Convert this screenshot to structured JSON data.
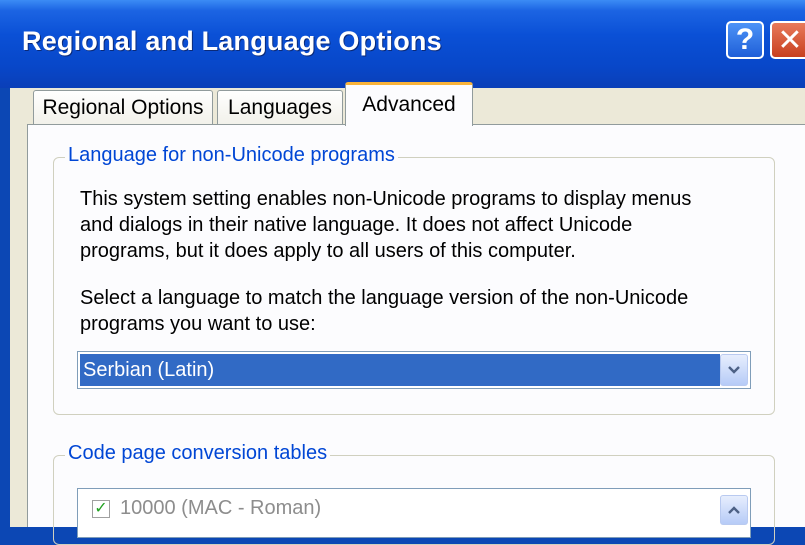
{
  "window": {
    "title": "Regional and Language Options",
    "help_glyph": "?",
    "close_glyph": "✕"
  },
  "tabs": [
    {
      "label": "Regional Options",
      "selected": false
    },
    {
      "label": "Languages",
      "selected": false
    },
    {
      "label": "Advanced",
      "selected": true
    }
  ],
  "non_unicode_group": {
    "legend": "Language for non-Unicode programs",
    "description_lines": [
      "This system setting enables non-Unicode programs to display menus",
      "and dialogs in their native language. It does not affect Unicode",
      "programs, but it does apply to all users of this computer."
    ],
    "prompt_lines": [
      "Select a language to match the language version of the non-Unicode",
      "programs you want to use:"
    ],
    "language_select": {
      "value": "Serbian (Latin)",
      "dropdown_icon": "chevron-down-icon"
    }
  },
  "code_page_group": {
    "legend": "Code page conversion tables",
    "items": [
      {
        "label": "10000 (MAC - Roman)",
        "checked": true
      }
    ],
    "scroll_icon": "chevron-up-icon"
  },
  "colors": {
    "titlebar": "#0a50d6",
    "legend_text": "#0046d5",
    "selection": "#316ac5",
    "tab_highlight": "#f9b33a",
    "close_button": "#c8401f"
  }
}
